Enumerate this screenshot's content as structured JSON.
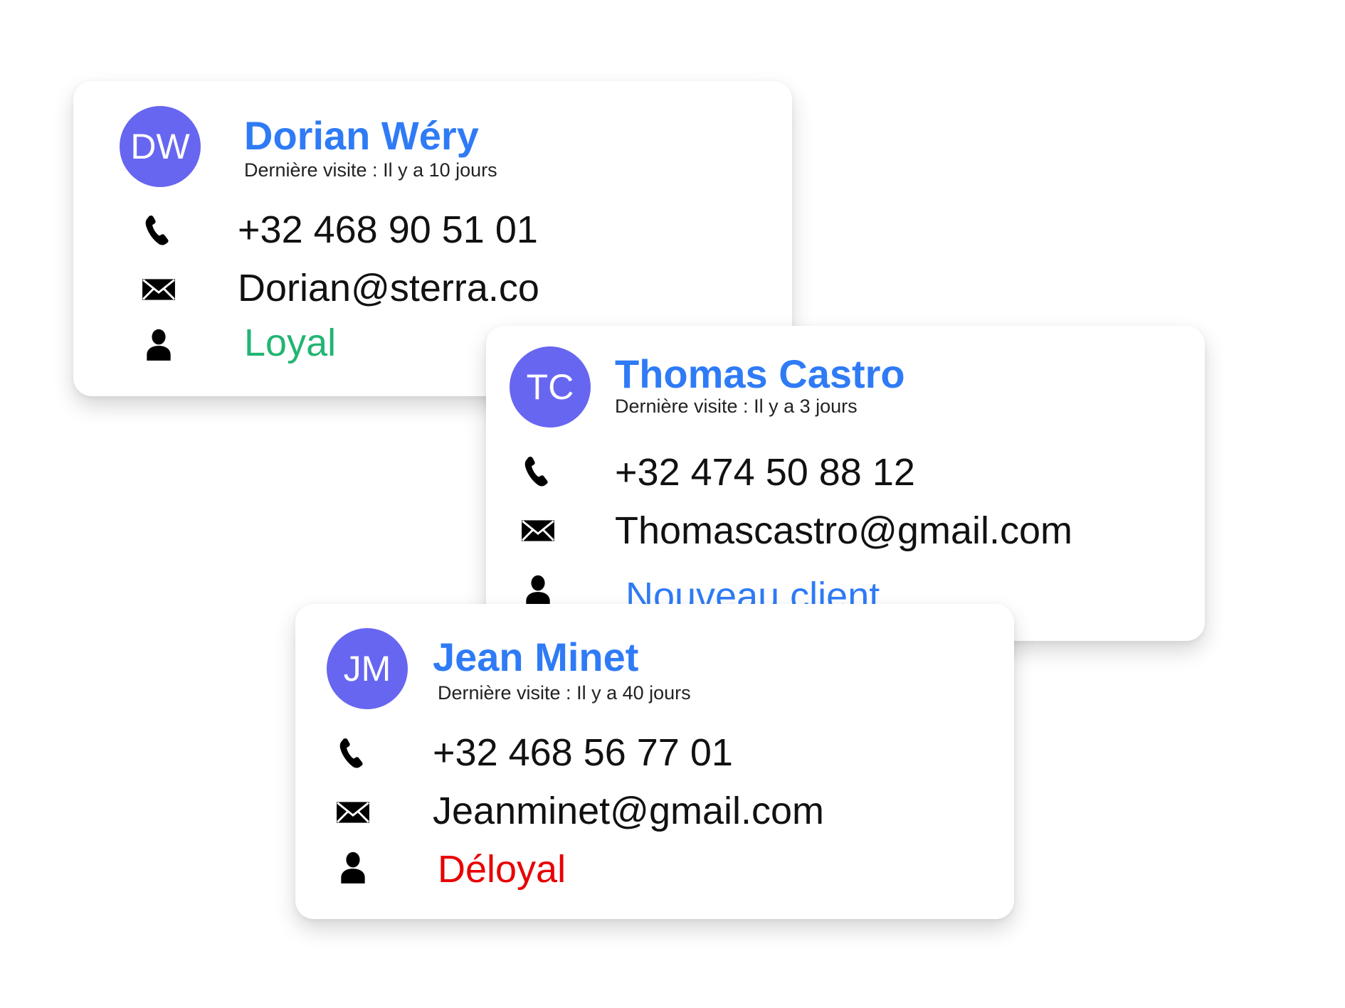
{
  "colors": {
    "name": "#2f7bf6",
    "avatar": "#6766f1",
    "loyal": "#22b573",
    "new": "#2f7bf6",
    "disloyal": "#e80000"
  },
  "cards": [
    {
      "initials": "DW",
      "name": "Dorian Wéry",
      "last_visit": "Dernière visite : Il y a 10 jours",
      "phone": "+32 468 90 51 01",
      "email": "Dorian@sterra.co",
      "status": "Loyal",
      "status_color": "#22b573",
      "icons": [
        "phone-icon",
        "envelope-icon",
        "user-icon"
      ]
    },
    {
      "initials": "TC",
      "name": "Thomas Castro",
      "last_visit": "Dernière visite : Il y a 3 jours",
      "phone": "+32 474 50 88 12",
      "email": "Thomascastro@gmail.com",
      "status": "Nouveau client",
      "status_color": "#2f7bf6",
      "icons": [
        "phone-icon",
        "envelope-icon",
        "user-icon"
      ]
    },
    {
      "initials": "JM",
      "name": "Jean Minet",
      "last_visit": "Dernière visite : Il y a 40 jours",
      "phone": "+32 468 56 77 01",
      "email": "Jeanminet@gmail.com",
      "status": "Déloyal",
      "status_color": "#e80000",
      "icons": [
        "phone-icon",
        "envelope-icon",
        "user-icon"
      ]
    }
  ]
}
